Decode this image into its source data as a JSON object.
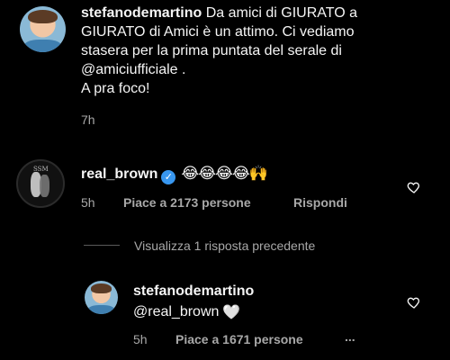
{
  "post": {
    "username": "stefanodemartino",
    "caption_lines": [
      "Da amici di GIURATO a",
      "GIURATO di Amici è un attimo. Ci vediamo",
      "stasera per la prima puntata del serale di",
      "@amiciufficiale .",
      "A pra foco!"
    ],
    "time": "7h"
  },
  "comment1": {
    "username": "real_brown",
    "emojis": "😂😂😂😂🙌",
    "time": "5h",
    "likes": "Piace a 2173 persone",
    "reply": "Rispondi"
  },
  "view_replies": "Visualizza 1 risposta precedente",
  "reply1": {
    "username": "stefanodemartino",
    "text": "@real_brown",
    "heart": "🤍",
    "time": "5h",
    "likes": "Piace a 1671 persone",
    "more": "..."
  },
  "colors": {
    "background": "#000000",
    "text": "#f5f5f5",
    "muted": "#a8a8a8",
    "verified": "#3897f0"
  },
  "icons": {
    "like": "heart-outline-icon",
    "verified": "verified-badge-icon"
  }
}
